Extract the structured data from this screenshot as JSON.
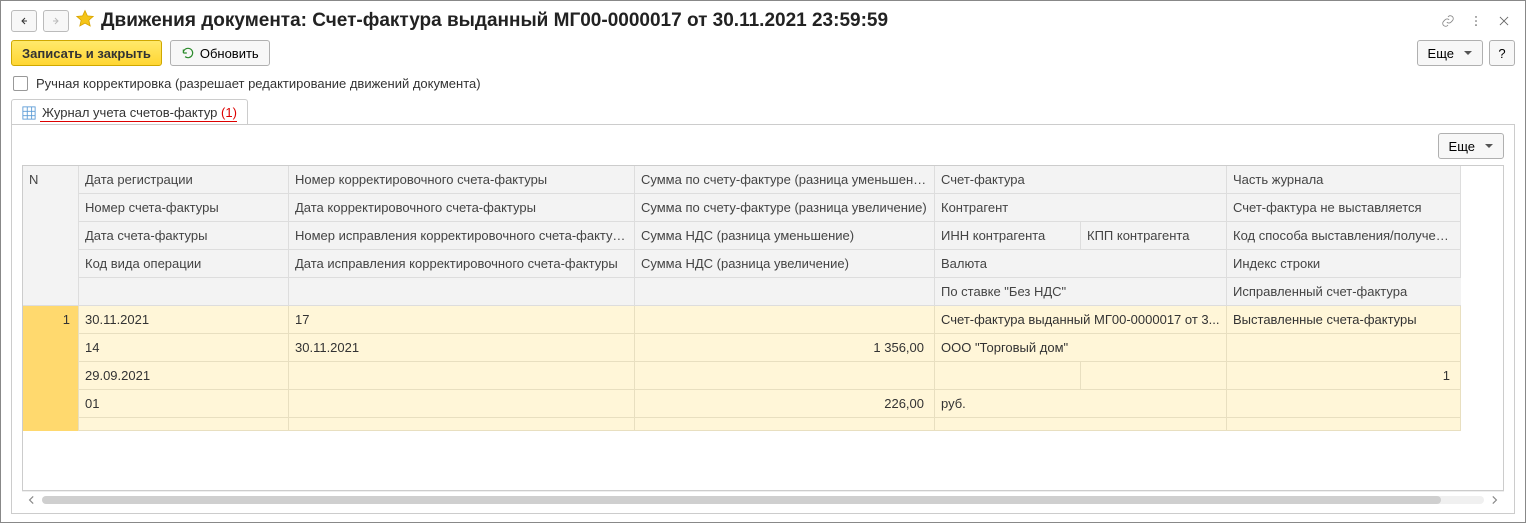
{
  "title": "Движения документа: Счет-фактура выданный МГ00-0000017 от 30.11.2021 23:59:59",
  "toolbar": {
    "save_close": "Записать и закрыть",
    "refresh": "Обновить",
    "more": "Еще",
    "help": "?"
  },
  "checkbox": {
    "label": "Ручная корректировка (разрешает редактирование движений документа)",
    "checked": false
  },
  "tab": {
    "label": "Журнал учета счетов-фактур",
    "count": "(1)"
  },
  "panel": {
    "more": "Еще"
  },
  "headers": {
    "n": "N",
    "r1": {
      "c1": "Дата регистрации",
      "c2": "Номер корректировочного счета-фактуры",
      "c3": "Сумма по счету-фактуре (разница уменьшение)",
      "c4": "Счет-фактура",
      "c5": "",
      "c6": "Часть журнала"
    },
    "r2": {
      "c1": "Номер счета-фактуры",
      "c2": "Дата корректировочного счета-фактуры",
      "c3": "Сумма по счету-фактуре (разница увеличение)",
      "c4": "Контрагент",
      "c5": "",
      "c6": "Счет-фактура не выставляется"
    },
    "r3": {
      "c1": "Дата счета-фактуры",
      "c2": "Номер исправления корректировочного счета-фактуры",
      "c3": "Сумма НДС (разница уменьшение)",
      "c4": "ИНН контрагента",
      "c5": "КПП контрагента",
      "c6": "Код способа выставления/получения"
    },
    "r4": {
      "c1": "Код вида операции",
      "c2": "Дата исправления корректировочного счета-фактуры",
      "c3": "Сумма НДС (разница увеличение)",
      "c4": "Валюта",
      "c5": "",
      "c6": "Индекс строки"
    },
    "r5": {
      "c1": "",
      "c2": "",
      "c3": "",
      "c4": "По ставке \"Без НДС\"",
      "c5": "",
      "c6": "Исправленный счет-фактура"
    }
  },
  "data": {
    "n": "1",
    "r1": {
      "c1": "30.11.2021",
      "c2": "17",
      "c3": "",
      "c4": "Счет-фактура выданный МГ00-0000017 от 3...",
      "c5": "",
      "c6": "Выставленные счета-фактуры"
    },
    "r2": {
      "c1": "14",
      "c2": "30.11.2021",
      "c3": "1 356,00",
      "c4": "ООО \"Торговый дом\"",
      "c5": "",
      "c6": ""
    },
    "r3": {
      "c1": "29.09.2021",
      "c2": "",
      "c3": "",
      "c4": "",
      "c5": "",
      "c6": "1"
    },
    "r4": {
      "c1": "01",
      "c2": "",
      "c3": "226,00",
      "c4": "руб.",
      "c5": "",
      "c6": ""
    },
    "r5": {
      "c1": "",
      "c2": "",
      "c3": "",
      "c4": "",
      "c5": "",
      "c6": ""
    }
  }
}
